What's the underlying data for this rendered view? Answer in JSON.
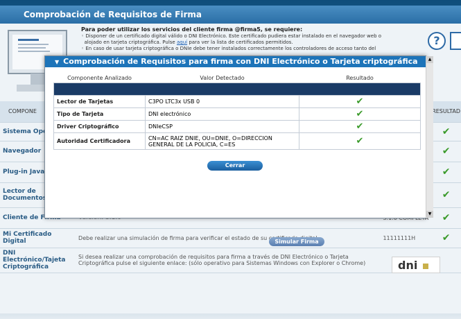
{
  "window_title": "Comprobación de Requisitos de Firma",
  "intro": {
    "heading": "Para poder utilizar los servicios del cliente firma @firma5, se requiere:",
    "bullet1a": "Disponer de un certificado digital válido o DNI Electrónico. Este certificado pudiera estar instalado en el navegador web o",
    "bullet1b_pre": "alojado en tarjeta criptográfica. Pulse ",
    "bullet1b_link": "aquí",
    "bullet1b_post": " para ver la lista de certificados permitidos.",
    "bullet2": "En caso de usar tarjeta criptográfica o DNIe debe tener instalados correctamente los controladores de acceso tanto del"
  },
  "help_icon": "?",
  "main_table": {
    "col_component": "COMPONE",
    "col_result": "RESULTAD",
    "rows": [
      {
        "label": "Sistema Oper",
        "value": "",
        "extra": ""
      },
      {
        "label": "Navegador",
        "value": "",
        "extra": ""
      },
      {
        "label": "Plug-in Java",
        "value": "",
        "extra": ""
      },
      {
        "label": "Lector de Documentos",
        "value": "",
        "extra": ""
      },
      {
        "label": "Cliente de Firma",
        "value": "Versión: 3.1.0",
        "extra": "3.1.0 COMPLETA"
      },
      {
        "label": "Mi Certificado Digital",
        "value": "Debe realizar una simulación de firma para verificar el estado de su certificado digital",
        "extra": "11111111H"
      },
      {
        "label": "DNI Electrónico/Tajeta Criptográfica",
        "value": "Si desea realizar una comprobación de requisitos para firma a través de DNI Electrónico o Tarjeta Criptográfica pulse el siguiente enlace: (sólo operativo para Sistemas Windows con Explorer o Chrome)",
        "extra": ""
      }
    ],
    "simular_button": "Simular Firma",
    "dni_logo": "dni"
  },
  "dialog": {
    "title": "Comprobación de Requisitos para firma con DNI Electrónico o Tarjeta criptográfica",
    "headers": [
      "Componente Analizado",
      "Valor Detectado",
      "Resultado"
    ],
    "rows": [
      {
        "component": "Lector de Tarjetas",
        "value": "C3PO LTC3x USB 0"
      },
      {
        "component": "Tipo de Tarjeta",
        "value": "DNI electrónico"
      },
      {
        "component": "Driver Criptográfico",
        "value": "DNIeCSP"
      },
      {
        "component": "Autoridad Certificadora",
        "value": "CN=AC RAIZ DNIE, OU=DNIE, O=DIRECCION GENERAL DE LA POLICIA, C=ES"
      }
    ],
    "close_button": "Cerrar"
  },
  "colors": {
    "accent": "#1d74b9",
    "ok": "#3a9a2a",
    "dark_bar": "#1a3b66"
  }
}
